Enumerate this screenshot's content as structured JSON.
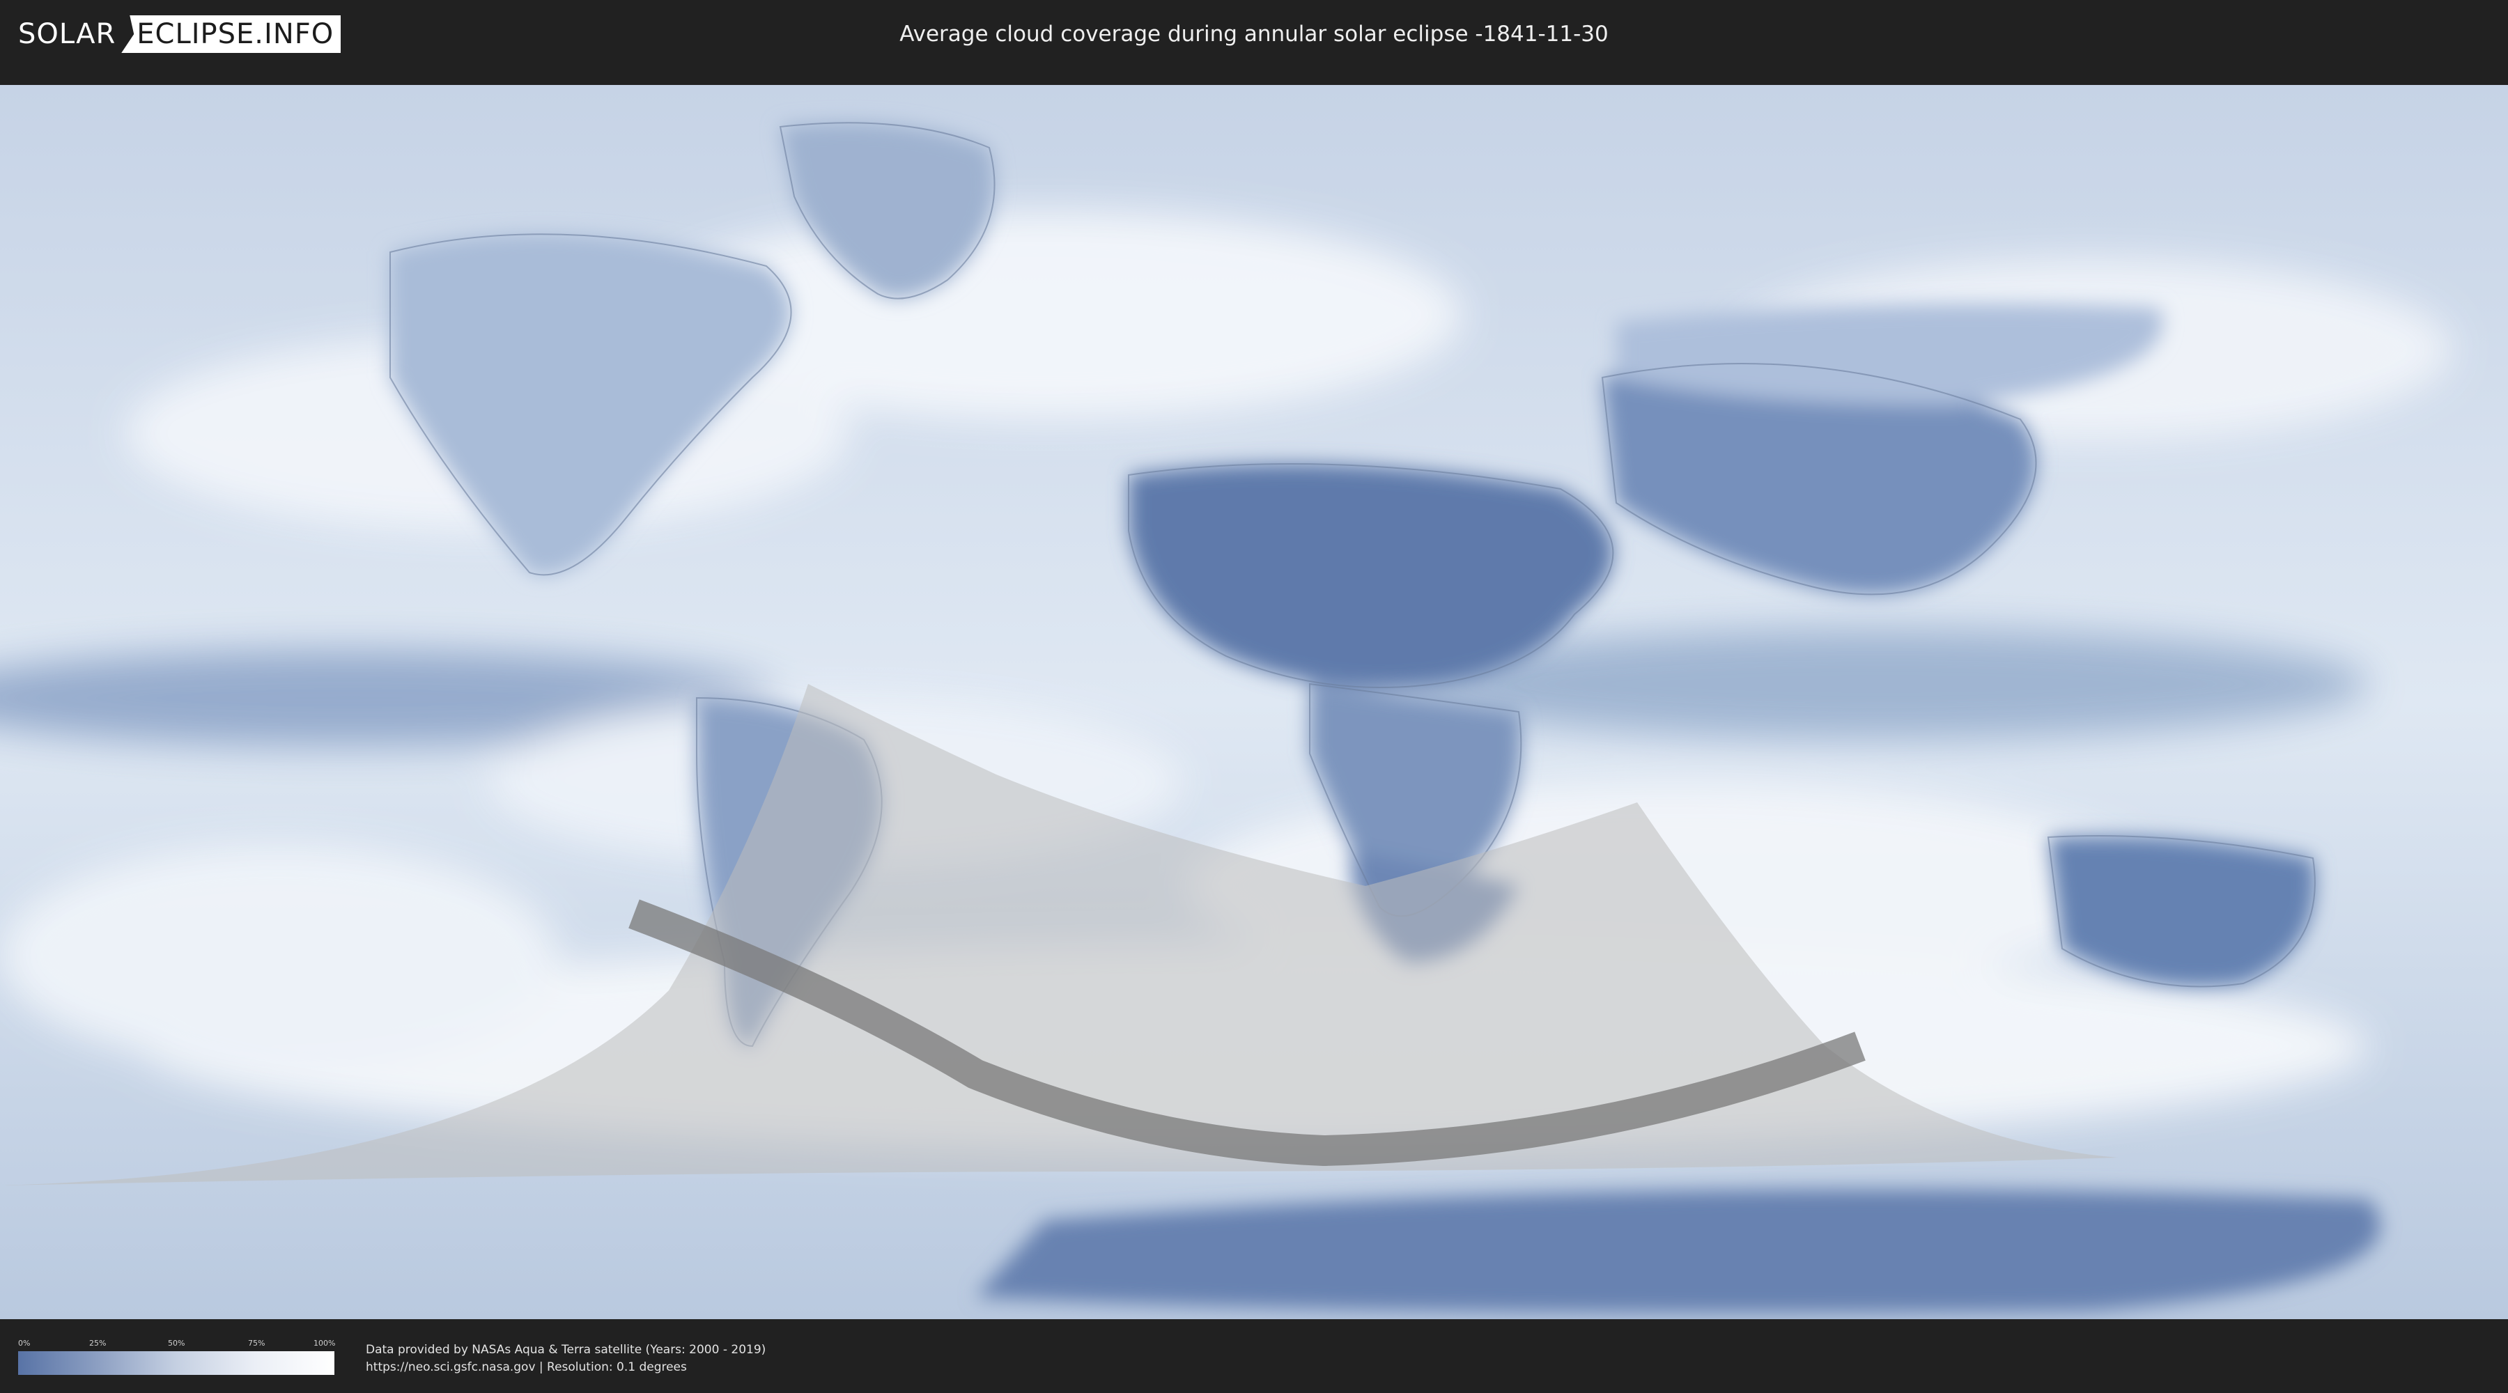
{
  "header": {
    "logo_left": "SOLAR",
    "logo_right": "ECLIPSE.INFO",
    "title": "Average cloud coverage during annular solar eclipse -1841-11-30"
  },
  "map": {
    "icon": "world-cloud-map",
    "colors": {
      "cloud_clear": "#5873a6",
      "cloud_full": "#ffffff",
      "penumbra_overlay": "#bfbfbf",
      "annular_path": "#7a7a7a"
    }
  },
  "legend": {
    "ticks": [
      "0%",
      "25%",
      "50%",
      "75%",
      "100%"
    ]
  },
  "footer": {
    "credit_line1": "Data provided by NASAs Aqua & Terra satellite (Years: 2000 - 2019)",
    "credit_line2": "https://neo.sci.gsfc.nasa.gov | Resolution: 0.1 degrees"
  }
}
